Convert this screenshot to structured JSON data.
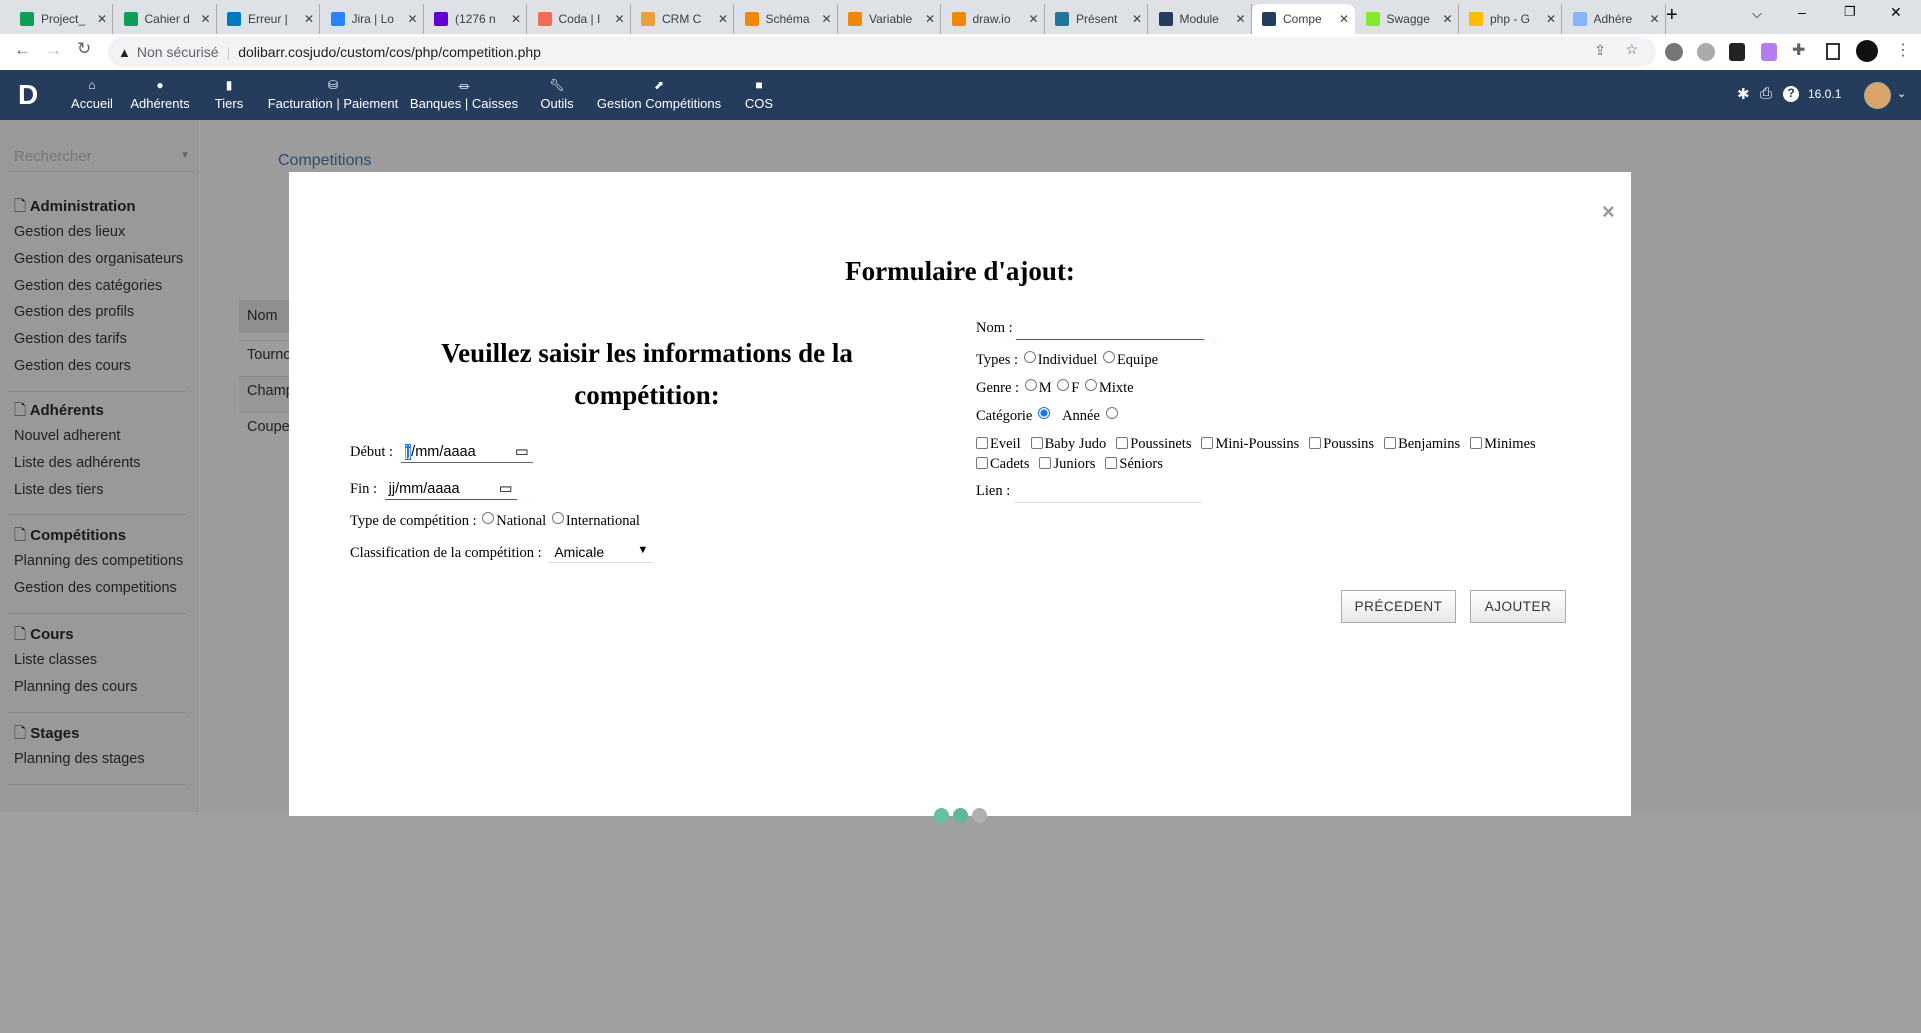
{
  "browser": {
    "tabs": [
      {
        "title": "Project_",
        "color": "#0f9d58"
      },
      {
        "title": "Cahier d",
        "color": "#0f9d58"
      },
      {
        "title": "Erreur |",
        "color": "#0079bf"
      },
      {
        "title": "Jira | Lo",
        "color": "#2684ff"
      },
      {
        "title": "(1276 n",
        "color": "#6001d2"
      },
      {
        "title": "Coda | I",
        "color": "#f46a54"
      },
      {
        "title": "CRM C",
        "color": "#e8a13a"
      },
      {
        "title": "Schéma",
        "color": "#f08705"
      },
      {
        "title": "Variable",
        "color": "#f08705"
      },
      {
        "title": "draw.io",
        "color": "#f08705"
      },
      {
        "title": "Présent",
        "color": "#21759b"
      },
      {
        "title": "Module",
        "color": "#263c5c"
      },
      {
        "title": "Compe",
        "color": "#263c5c"
      },
      {
        "title": "Swagge",
        "color": "#85ea2d"
      },
      {
        "title": "php - G",
        "color": "#fbbc04"
      },
      {
        "title": "Adhére",
        "color": "#8ab4f8"
      }
    ],
    "active_tab": 12,
    "new_tab": "+",
    "security": "Non sécurisé",
    "url": "dolibarr.cosjudo/custom/cos/php/competition.php"
  },
  "nav": {
    "logo": "D",
    "items": [
      {
        "label": "Accueil",
        "icon": "home-icon"
      },
      {
        "label": "Adhérents",
        "icon": "user-icon"
      },
      {
        "label": "Tiers",
        "icon": "building-icon"
      },
      {
        "label": "Facturation | Paiement",
        "icon": "coins-icon"
      },
      {
        "label": "Banques | Caisses",
        "icon": "bank-icon"
      },
      {
        "label": "Outils",
        "icon": "wrench-icon"
      },
      {
        "label": "Gestion Compétitions",
        "icon": "external-icon"
      },
      {
        "label": "COS",
        "icon": "file-icon"
      }
    ],
    "version": "16.0.1"
  },
  "sidebar": {
    "search_placeholder": "Rechercher",
    "sections": [
      {
        "title": "Administration",
        "items": [
          "Gestion des lieux",
          "Gestion des organisateurs",
          "Gestion des catégories",
          "Gestion des profils",
          "Gestion des tarifs",
          "Gestion des cours"
        ]
      },
      {
        "title": "Adhérents",
        "items": [
          "Nouvel adherent",
          "Liste des adhérents",
          "Liste des tiers"
        ]
      },
      {
        "title": "Compétitions",
        "items": [
          "Planning des competitions",
          "Gestion des competitions"
        ]
      },
      {
        "title": "Cours",
        "items": [
          "Liste classes",
          "Planning des cours"
        ]
      },
      {
        "title": "Stages",
        "items": [
          "Planning des stages"
        ]
      }
    ]
  },
  "page": {
    "title": "Competitions",
    "table_header": "Nom",
    "rows": [
      "Tourno",
      "Champ",
      "Coupe"
    ]
  },
  "modal": {
    "title": "Formulaire d'ajout:",
    "subtitle": "Veuillez saisir les informations de la compétition:",
    "close": "×",
    "debut_label": "Début :",
    "fin_label": "Fin :",
    "date_placeholder": "jj/mm/aaaa",
    "date_first": "jj",
    "date_rest": "/mm/aaaa",
    "type_label": "Type de compétition :",
    "type_options": [
      "National",
      "International"
    ],
    "class_label": "Classification de la compétition :",
    "class_value": "Amicale",
    "nom_label": "Nom :",
    "types_label": "Types :",
    "types_options": [
      "Individuel",
      "Equipe"
    ],
    "genre_label": "Genre :",
    "genre_options": [
      "M",
      "F",
      "Mixte"
    ],
    "categorie_label": "Catégorie",
    "annee_label": "Année",
    "categorie_selected": true,
    "categories": [
      "Eveil",
      "Baby Judo",
      "Poussinets",
      "Mini-Poussins",
      "Poussins",
      "Benjamins",
      "Minimes",
      "Cadets",
      "Juniors",
      "Séniors"
    ],
    "lien_label": "Lien :",
    "prev": "PRÉCEDENT",
    "add": "AJOUTER"
  },
  "loader_colors": [
    "#66c2a5",
    "#5fb89a",
    "#b0b0b0"
  ]
}
